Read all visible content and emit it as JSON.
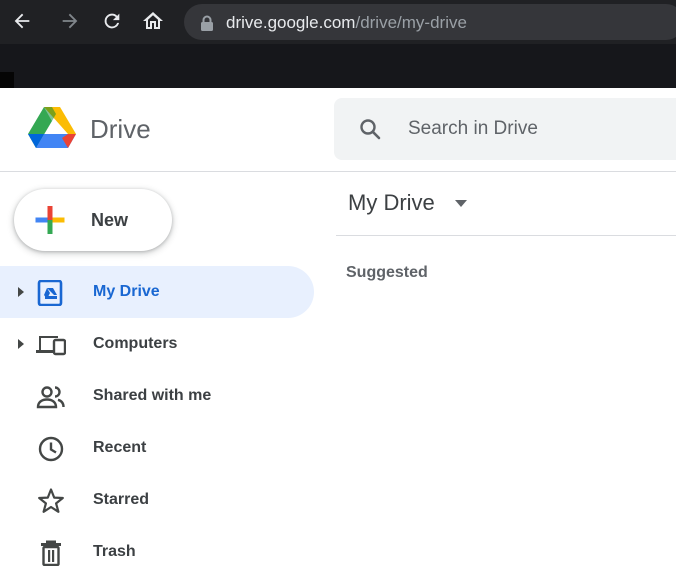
{
  "browser": {
    "url_host": "drive.google.com",
    "url_path": "/drive/my-drive"
  },
  "header": {
    "app_name": "Drive",
    "search_placeholder": "Search in Drive"
  },
  "new_button": {
    "label": "New"
  },
  "sidebar": {
    "items": [
      {
        "label": "My Drive",
        "icon": "my-drive-icon",
        "active": true,
        "expandable": true
      },
      {
        "label": "Computers",
        "icon": "computers-icon",
        "active": false,
        "expandable": true
      },
      {
        "label": "Shared with me",
        "icon": "shared-with-me-icon",
        "active": false,
        "expandable": false
      },
      {
        "label": "Recent",
        "icon": "clock-icon",
        "active": false,
        "expandable": false
      },
      {
        "label": "Starred",
        "icon": "star-icon",
        "active": false,
        "expandable": false
      },
      {
        "label": "Trash",
        "icon": "trash-icon",
        "active": false,
        "expandable": false
      }
    ]
  },
  "main": {
    "title": "My Drive",
    "section": "Suggested"
  },
  "colors": {
    "accent_blue": "#1967d2",
    "active_bg": "#e8f0fe",
    "chrome_bg": "#202124"
  }
}
